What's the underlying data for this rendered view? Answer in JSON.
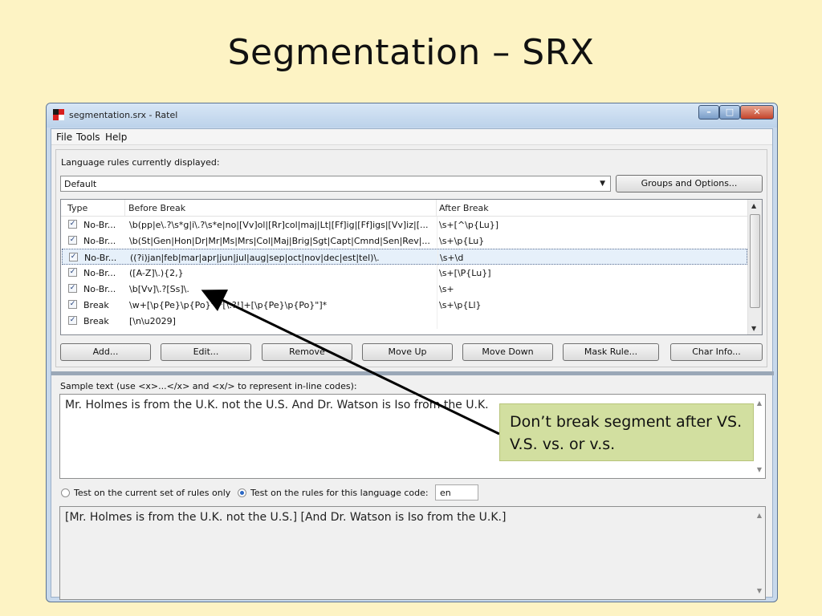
{
  "slide": {
    "title": "Segmentation – SRX"
  },
  "window": {
    "title": "segmentation.srx - Ratel",
    "controls": {
      "minimize": "–",
      "maximize": "□",
      "close": "✕"
    }
  },
  "menubar": {
    "items": [
      "File",
      "Tools",
      "Help"
    ]
  },
  "rules": {
    "language_label": "Language rules currently displayed:",
    "language_value": "Default",
    "groups_button": "Groups and Options...",
    "columns": [
      "Type",
      "Before Break",
      "After Break"
    ],
    "rows": [
      {
        "checked": true,
        "type": "No-Br...",
        "before": "\\b(pp|e\\.?\\s*g|i\\.?\\s*e|no|[Vv]ol|[Rr]col|maj|Lt|[Ff]ig|[Ff]igs|[Vv]iz|[...",
        "after": "\\s+[^\\p{Lu}]",
        "selected": false
      },
      {
        "checked": true,
        "type": "No-Br...",
        "before": "\\b(St|Gen|Hon|Dr|Mr|Ms|Mrs|Col|Maj|Brig|Sgt|Capt|Cmnd|Sen|Rev|...",
        "after": "\\s+\\p{Lu}",
        "selected": false
      },
      {
        "checked": true,
        "type": "No-Br...",
        "before": "((?i)jan|feb|mar|apr|jun|jul|aug|sep|oct|nov|dec|est|tel)\\.",
        "after": "\\s+\\d",
        "selected": true
      },
      {
        "checked": true,
        "type": "No-Br...",
        "before": "([A-Z]\\.){2,}",
        "after": "\\s+[\\P{Lu}]",
        "selected": false
      },
      {
        "checked": true,
        "type": "No-Br...",
        "before": "\\b[Vv]\\.?[Ss]\\.",
        "after": "\\s+",
        "selected": false
      },
      {
        "checked": true,
        "type": "Break",
        "before": "\\w+[\\p{Pe}\\p{Po}\"]*[\\.?!]+[\\p{Pe}\\p{Po}\"]*",
        "after": "\\s+\\p{Ll}",
        "selected": false
      },
      {
        "checked": true,
        "type": "Break",
        "before": "[\\n\\u2029]",
        "after": "",
        "selected": false
      }
    ],
    "buttons": [
      "Add...",
      "Edit...",
      "Remove",
      "Move Up",
      "Move Down",
      "Mask Rule...",
      "Char Info..."
    ]
  },
  "sample": {
    "label": "Sample text (use <x>...</x> and <x/> to represent in-line codes):",
    "text": "Mr. Holmes is from the U.K. not the U.S. And Dr. Watson is Iso from the U.K.",
    "radio_current": "Test on the current set of rules only",
    "radio_language": "Test on the rules for this language code:",
    "language_code": "en",
    "result": "[Mr. Holmes is from the U.K. not the U.S.] [And Dr. Watson is Iso from the U.K.]"
  },
  "callout": {
    "text": "Don’t break segment after VS. V.S. vs. or v.s."
  },
  "colors": {
    "slide_background": "#fdf3c4",
    "callout_background": "#d2dfa0",
    "window_frame": "#c8d9ec"
  }
}
